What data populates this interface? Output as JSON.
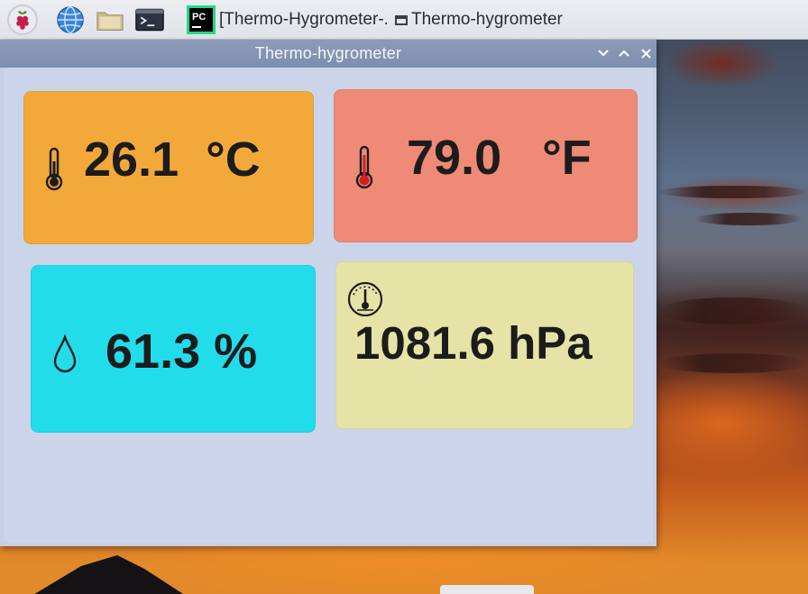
{
  "taskbar": {
    "items": [
      {
        "label": "[Thermo-Hygrometer-..."
      },
      {
        "label": "Thermo-hygrometer"
      }
    ],
    "launcher_icons": [
      "raspberry-menu-icon",
      "globe-icon",
      "folder-icon",
      "terminal-icon",
      "pycharm-icon"
    ],
    "pycharm_badge": "PC",
    "terminal_prompt": ">_"
  },
  "window": {
    "title": "Thermo-hygrometer",
    "controls": {
      "minimize": "˅",
      "maximize": "˄",
      "close": "✕"
    }
  },
  "readings": {
    "celsius": {
      "text": "26.1  °C",
      "icon": "thermometer-icon",
      "color": "#f2a93a"
    },
    "fahrenheit": {
      "text": "79.0   °F",
      "icon": "thermometer-hot-icon",
      "color": "#ef8a76"
    },
    "humidity": {
      "text": "61.3 %",
      "icon": "water-drop-icon",
      "color": "#22dcea"
    },
    "pressure": {
      "text": "1081.6 hPa",
      "icon": "barometer-gauge-icon",
      "color": "#e6e3a6"
    }
  },
  "colors": {
    "window_bg": "#ccd4ea",
    "titlebar": "#8d9bb9",
    "taskbar": "#e3e6ec"
  }
}
